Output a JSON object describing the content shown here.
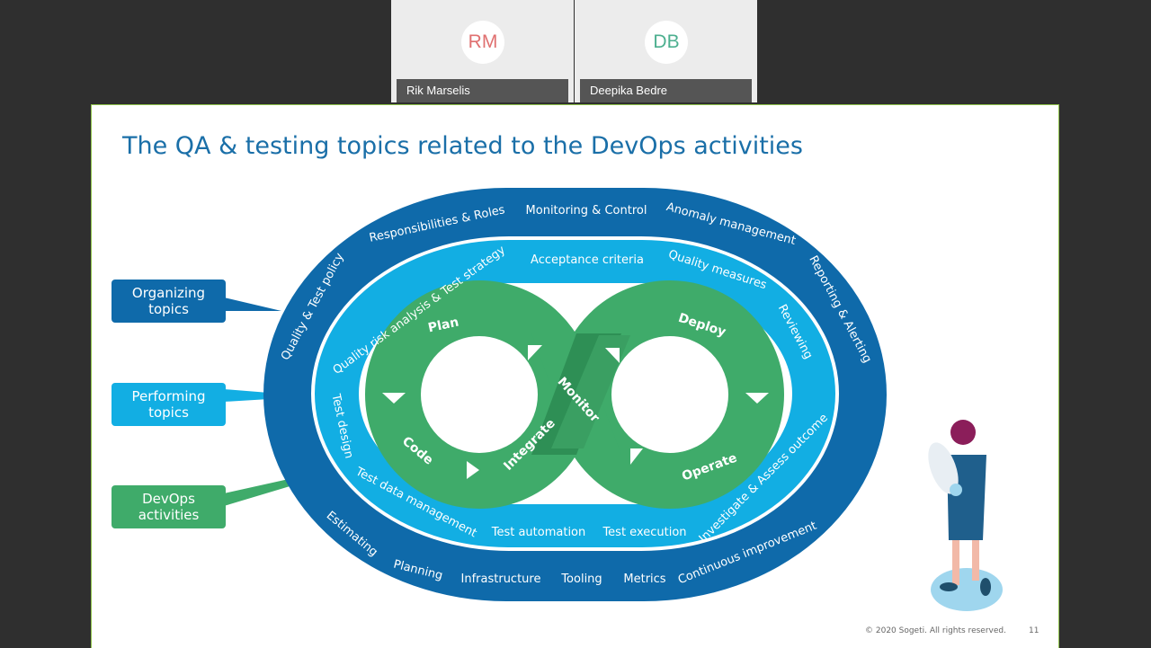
{
  "participants": [
    {
      "initials": "RM",
      "name": "Rik Marselis",
      "color": "#e07070"
    },
    {
      "initials": "DB",
      "name": "Deepika Bedre",
      "color": "#4caf8f"
    }
  ],
  "slide": {
    "title": "The QA & testing topics related to the DevOps activities",
    "callouts": {
      "organizing": "Organizing topics",
      "performing": "Performing topics",
      "devops": "DevOps activities"
    },
    "outer_ring": [
      "Responsibilities & Roles",
      "Monitoring & Control",
      "Anomaly management",
      "Reporting & Alerting",
      "Quality & Test policy",
      "Estimating",
      "Planning",
      "Infrastructure",
      "Tooling",
      "Metrics",
      "Continuous improvement"
    ],
    "middle_ring": [
      "Quality risk analysis & Test strategy",
      "Acceptance criteria",
      "Quality measures",
      "Reviewing",
      "Test design",
      "Test data management",
      "Test automation",
      "Test execution",
      "Investigate & Assess outcome"
    ],
    "devops": [
      "Plan",
      "Code",
      "Integrate",
      "Monitor",
      "Deploy",
      "Operate"
    ],
    "footer": "© 2020 Sogeti. All rights reserved.",
    "page_number": "11",
    "colors": {
      "dark_blue": "#0f6aaa",
      "light_blue": "#12aee3",
      "green": "#3fab6a",
      "title": "#1a6fa8"
    }
  }
}
